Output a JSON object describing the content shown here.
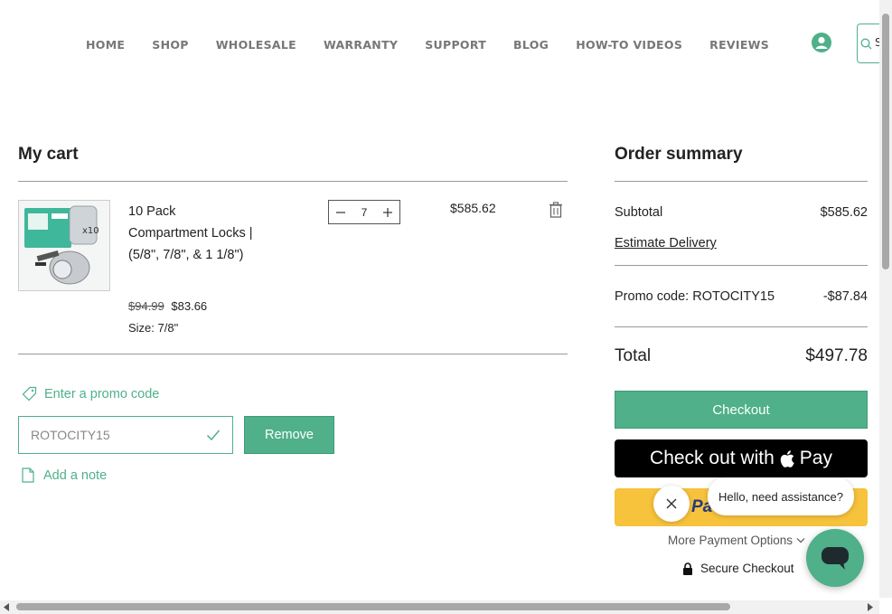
{
  "nav": {
    "items": [
      "HOME",
      "SHOP",
      "WHOLESALE",
      "WARRANTY",
      "SUPPORT",
      "BLOG",
      "HOW-TO VIDEOS",
      "REVIEWS"
    ]
  },
  "header": {
    "search_partial": "S"
  },
  "cart": {
    "title": "My cart",
    "item": {
      "name": "10 Pack Compartment Locks | (5/8\", 7/8\", & 1 1/8\")",
      "price_old": "$94.99",
      "price_new": "$83.66",
      "size": "Size: 7/8\"",
      "quantity": "7",
      "line_total": "$585.62"
    },
    "promo_link": "Enter a promo code",
    "promo_value": "ROTOCITY15",
    "remove_label": "Remove",
    "note_link": "Add a note"
  },
  "summary": {
    "title": "Order summary",
    "subtotal_label": "Subtotal",
    "subtotal_value": "$585.62",
    "estimate_delivery": "Estimate Delivery",
    "promo_label": "Promo code: ROTOCITY15",
    "promo_value": "-$87.84",
    "total_label": "Total",
    "total_value": "$497.78",
    "checkout_label": "Checkout",
    "applepay_prefix": "Check out with",
    "applepay_suffix": "Pay",
    "paypal_partial": "Pa",
    "more_options": "More Payment Options",
    "secure_checkout": "Secure Checkout"
  },
  "chat": {
    "greeting": "Hello, need assistance?"
  },
  "colors": {
    "accent": "#4fb08a",
    "paypal": "#f7c23c"
  }
}
